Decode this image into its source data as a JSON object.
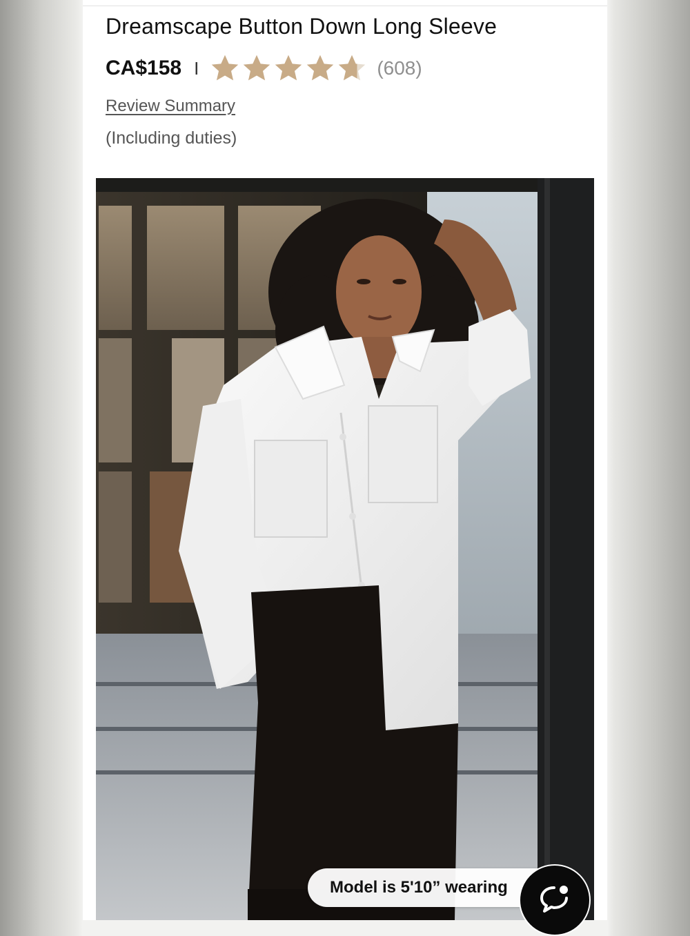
{
  "product": {
    "title": "Dreamscape Button Down Long Sleeve",
    "price": "CA$158",
    "separator": "I",
    "rating": 4.7,
    "rating_max": 5,
    "review_count": "(608)",
    "review_summary_link": "Review Summary",
    "duties_note": "(Including duties)"
  },
  "image": {
    "model_info": "Model is 5'10” wearing"
  },
  "colors": {
    "star_fill": "#C8AB87",
    "star_empty": "#E6DDD0"
  },
  "icons": {
    "rating_star": "star-icon",
    "chat": "chat-bubble-icon"
  }
}
